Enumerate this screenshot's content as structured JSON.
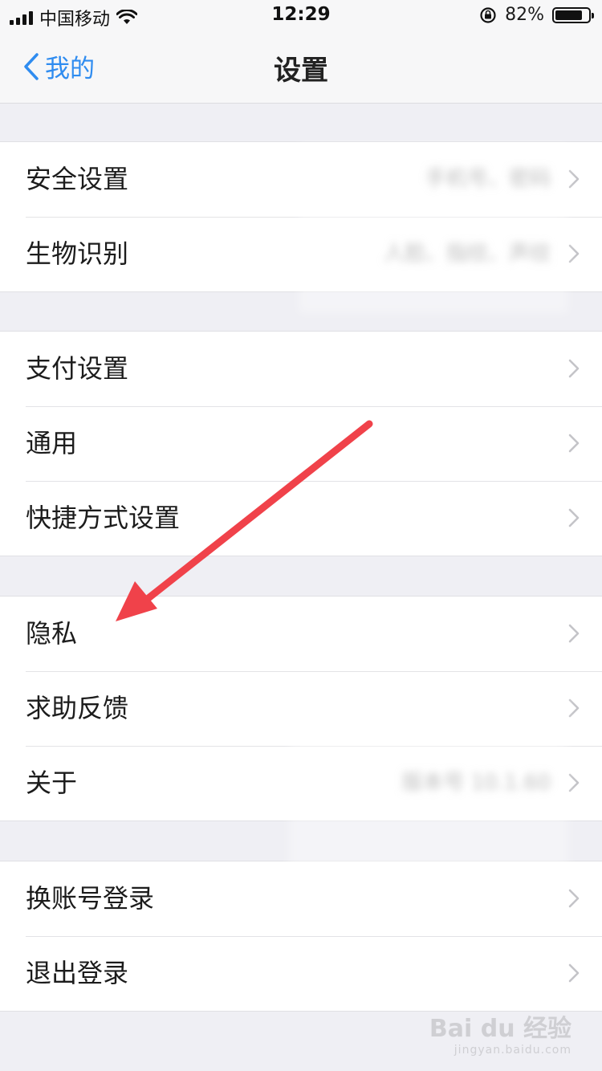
{
  "status": {
    "carrier": "中国移动",
    "time": "12:29",
    "battery": "82%"
  },
  "nav": {
    "back_label": "我的",
    "title": "设置"
  },
  "groups": [
    [
      {
        "label": "安全设置",
        "value": "手机号、密码"
      },
      {
        "label": "生物识别",
        "value": "人脸、指纹、声纹"
      }
    ],
    [
      {
        "label": "支付设置"
      },
      {
        "label": "通用"
      },
      {
        "label": "快捷方式设置"
      }
    ],
    [
      {
        "label": "隐私"
      },
      {
        "label": "求助反馈"
      },
      {
        "label": "关于",
        "value": "版本号 10.1.60"
      }
    ],
    [
      {
        "label": "换账号登录"
      },
      {
        "label": "退出登录"
      }
    ]
  ],
  "watermark": {
    "brand": "Bai du 经验",
    "url": "jingyan.baidu.com"
  },
  "colors": {
    "accent": "#2f8cf0",
    "annotation_arrow": "#f0424a"
  }
}
